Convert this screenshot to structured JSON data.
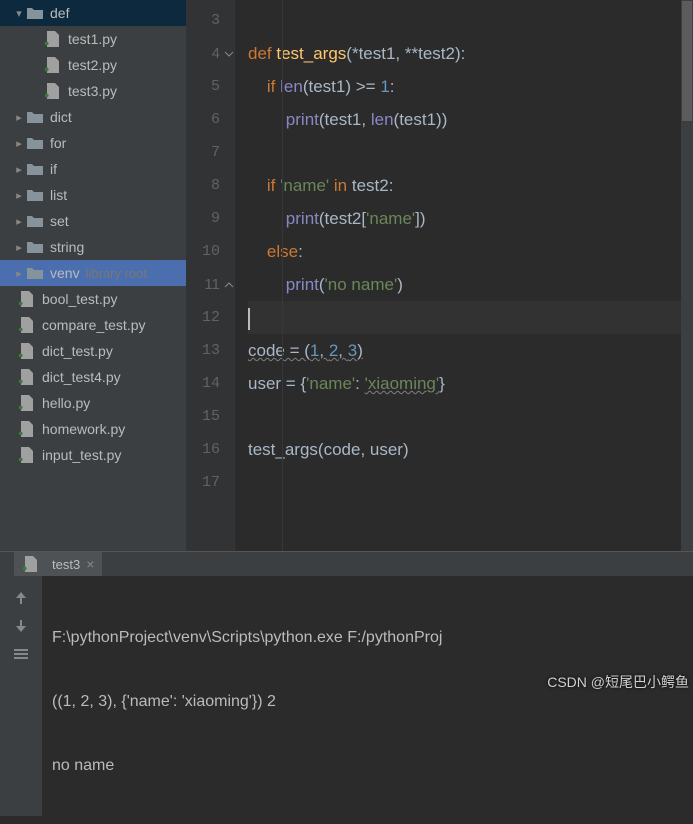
{
  "tree": {
    "def": "def",
    "test1": "test1.py",
    "test2": "test2.py",
    "test3": "test3.py",
    "dict": "dict",
    "for": "for",
    "if": "if",
    "list": "list",
    "set": "set",
    "string": "string",
    "venv": "venv",
    "venv_sub": "library root",
    "bool_test": "bool_test.py",
    "compare_test": "compare_test.py",
    "dict_test": "dict_test.py",
    "dict_test4": "dict_test4.py",
    "hello": "hello.py",
    "homework": "homework.py",
    "input_test": "input_test.py"
  },
  "gutter": [
    "3",
    "4",
    "5",
    "6",
    "7",
    "8",
    "9",
    "10",
    "11",
    "12",
    "13",
    "14",
    "15",
    "16",
    "17"
  ],
  "code": {
    "l4_def": "def ",
    "l4_fn": "test_args",
    "l4_rest": "(*test1, **test2):",
    "l5_if": "if ",
    "l5_len": "len",
    "l5_t1": "(test1) >= ",
    "l5_one": "1",
    "l5_colon": ":",
    "l6_print": "print",
    "l6_a": "(test1, ",
    "l6_len": "len",
    "l6_b": "(test1))",
    "l8_if": "if ",
    "l8_name": "'name'",
    "l8_in": " in ",
    "l8_t2": "test2:",
    "l9_print": "print",
    "l9_a": "(test2[",
    "l9_name": "'name'",
    "l9_b": "])",
    "l10_else": "else",
    "l10_colon": ":",
    "l11_print": "print",
    "l11_a": "(",
    "l11_str": "'no name'",
    "l11_b": ")",
    "l13_a": "code = (",
    "l13_1": "1",
    "l13_c1": ", ",
    "l13_2": "2",
    "l13_c2": ", ",
    "l13_3": "3",
    "l13_b": ")",
    "l14_a": "user = {",
    "l14_k": "'name'",
    "l14_c": ": ",
    "l14_v": "'xiaoming'",
    "l14_b": "}",
    "l16": "test_args(code, user)"
  },
  "tab": {
    "label": "test3"
  },
  "console": {
    "l1": "F:\\pythonProject\\venv\\Scripts\\python.exe F:/pythonProj",
    "l2": "((1, 2, 3), {'name': 'xiaoming'}) 2",
    "l3": "no name"
  },
  "watermark": "CSDN @短尾巴小鳄鱼"
}
